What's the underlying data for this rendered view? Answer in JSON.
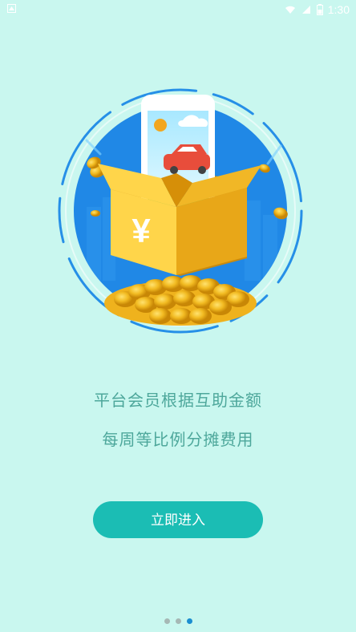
{
  "status_bar": {
    "time": "1:30",
    "icons": [
      "wifi-icon",
      "signal-icon",
      "battery-icon"
    ]
  },
  "colors": {
    "background": "#c9f7ef",
    "primary_text": "#4da79b",
    "button": "#1bbdb4",
    "active_dot": "#1b8ed0",
    "inactive_dot": "#a6b8b5"
  },
  "onboarding": {
    "line_1": "平台会员根据互助金额",
    "line_2": "每周等比例分摊费用",
    "button_label": "立即进入",
    "page_indicator": {
      "total_pages": 3,
      "active_page": 3
    }
  },
  "illustration": {
    "currency_symbol": "¥"
  }
}
